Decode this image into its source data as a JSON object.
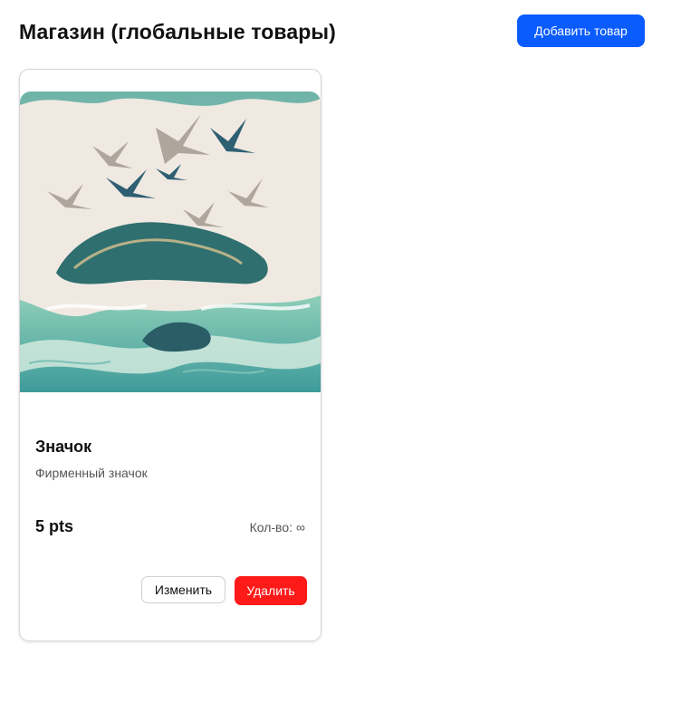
{
  "header": {
    "title": "Магазин (глобальные товары)",
    "add_button_label": "Добавить товар",
    "accent_color": "#0b5cff"
  },
  "products": [
    {
      "image_icon": "seabirds-over-waves-artwork",
      "title": "Значок",
      "description": "Фирменный значок",
      "price": "5 pts",
      "quantity_label": "Кол-во:",
      "quantity_value": "∞",
      "edit_label": "Изменить",
      "delete_label": "Удалить",
      "delete_color": "#ff1a1a"
    }
  ]
}
